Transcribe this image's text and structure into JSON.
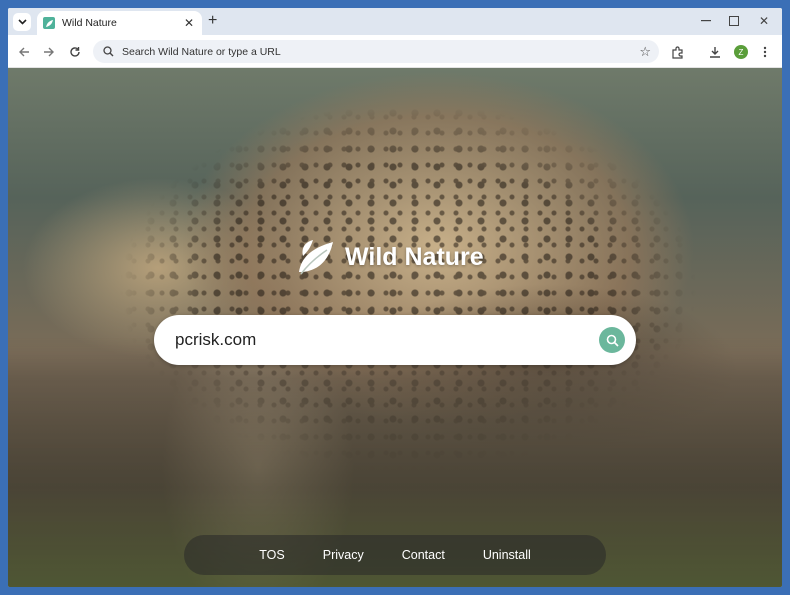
{
  "browser": {
    "tab": {
      "title": "Wild Nature",
      "favicon": "leaf-favicon-icon"
    },
    "new_tab_label": "+",
    "window_controls": [
      "minimize-icon",
      "maximize-icon",
      "close-icon"
    ],
    "omnibox_placeholder": "Search Wild Nature or type a URL",
    "profile_initial": "Z"
  },
  "page": {
    "brand_name": "Wild Nature",
    "search_value": "pcrisk.com",
    "footer_links": [
      "TOS",
      "Privacy",
      "Contact",
      "Uninstall"
    ]
  },
  "colors": {
    "accent": "#6bb79c",
    "desktop_background": "#3b6fb6",
    "tabstrip": "#dfe6f0"
  }
}
